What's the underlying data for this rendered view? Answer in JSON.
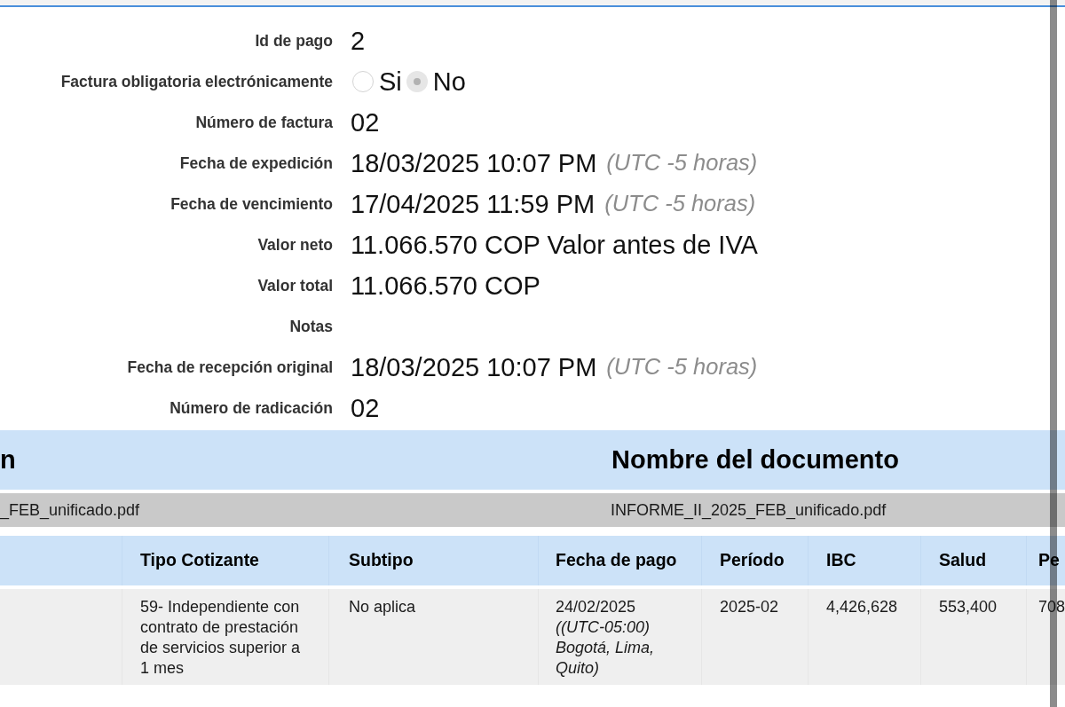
{
  "fields": [
    {
      "kind": "text",
      "label": "Id de pago",
      "value": "2"
    },
    {
      "kind": "radio",
      "label": "Factura obligatoria electrónicamente",
      "options": [
        {
          "label": "Si",
          "selected": false
        },
        {
          "label": "No",
          "selected": true
        }
      ]
    },
    {
      "kind": "text",
      "label": "Número de factura",
      "value": "02"
    },
    {
      "kind": "text",
      "label": "Fecha de expedición",
      "value": "18/03/2025 10:07 PM",
      "note": "(UTC -5 horas)"
    },
    {
      "kind": "text",
      "label": "Fecha de vencimiento",
      "value": "17/04/2025 11:59 PM",
      "note": "(UTC -5 horas)"
    },
    {
      "kind": "text",
      "label": "Valor neto",
      "value": "11.066.570 COP Valor antes de IVA"
    },
    {
      "kind": "text",
      "label": "Valor total",
      "value": "11.066.570 COP"
    },
    {
      "kind": "text",
      "label": "Notas"
    },
    {
      "kind": "text",
      "label": "Fecha de recepción original",
      "value": "18/03/2025 10:07 PM",
      "note": "(UTC -5 horas)"
    },
    {
      "kind": "text",
      "label": "Número de radicación",
      "value": "02"
    }
  ],
  "documents_table": {
    "columns": [
      "n",
      "Nombre del documento"
    ],
    "rows": [
      [
        "_FEB_unificado.pdf",
        "INFORME_II_2025_FEB_unificado.pdf"
      ]
    ]
  },
  "contributions_table": {
    "columns": [
      "Tipo Cotizante",
      "Subtipo",
      "Fecha de pago",
      "Período",
      "IBC",
      "Salud",
      "Pe"
    ],
    "rows": [
      [
        "59- Independiente con contrato de prestación de servicios superior a 1 mes",
        "No aplica",
        "24/02/2025 *((UTC-05:00) Bogotá, Lima, Quito)*",
        "2025-02",
        "4,426,628",
        "553,400",
        "708"
      ]
    ]
  }
}
